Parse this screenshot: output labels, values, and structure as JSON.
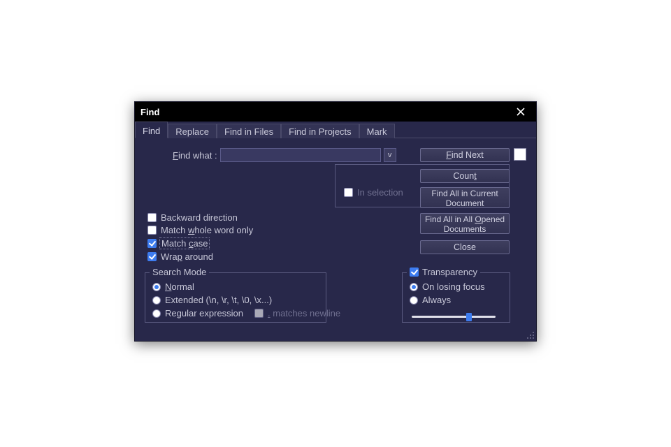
{
  "title": "Find",
  "tabs": [
    "Find",
    "Replace",
    "Find in Files",
    "Find in Projects",
    "Mark"
  ],
  "active_tab_index": 0,
  "find_what_label": "Find what :",
  "find_what_value": "",
  "dropdown_glyph": "v",
  "in_selection_label": "In selection",
  "in_selection_checked": false,
  "buttons": {
    "find_next": "Find Next",
    "count": "Count",
    "find_all_current": "Find All in Current Document",
    "find_all_opened": "Find All in All Opened Documents",
    "close": "Close"
  },
  "options": {
    "backward": {
      "label": "Backward direction",
      "checked": false
    },
    "whole_word": {
      "label": "Match whole word only",
      "checked": false
    },
    "match_case": {
      "label": "Match case",
      "checked": true
    },
    "wrap": {
      "label": "Wrap around",
      "checked": true
    }
  },
  "search_mode": {
    "legend": "Search Mode",
    "normal": "Normal",
    "extended": "Extended (\\n, \\r, \\t, \\0, \\x...)",
    "regex": "Regular expression",
    "dot_newline": ". matches newline",
    "selected": "normal"
  },
  "transparency": {
    "legend": "Transparency",
    "enabled": true,
    "on_losing_focus": "On losing focus",
    "always": "Always",
    "selected": "on_losing_focus",
    "slider_value": 0.65
  }
}
